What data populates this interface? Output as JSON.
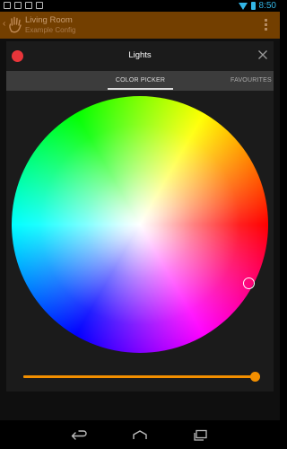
{
  "status_bar": {
    "time": "8:50",
    "notification_icons": [
      "image-icon",
      "image-icon",
      "calendar-icon",
      "notification-icon"
    ],
    "wifi_icon": "wifi-icon",
    "battery_icon": "battery-icon",
    "accent_color": "#33b5e5"
  },
  "action_bar": {
    "title": "Living Room",
    "subtitle": "Example Config",
    "background_color": "#733f00"
  },
  "dialog": {
    "title": "Lights",
    "tabs": [
      {
        "label": "COLOR PICKER",
        "selected": true
      },
      {
        "label": "FAVOURITES",
        "selected": false
      }
    ],
    "color_picker": {
      "selected_color": "#ff0000",
      "saturation_percent": 88
    },
    "brightness_percent": 100,
    "accent_color": "#f38f00",
    "close_color": "#e8353a"
  },
  "nav_bar": {
    "buttons": [
      "back-icon",
      "home-icon",
      "recents-icon"
    ]
  }
}
